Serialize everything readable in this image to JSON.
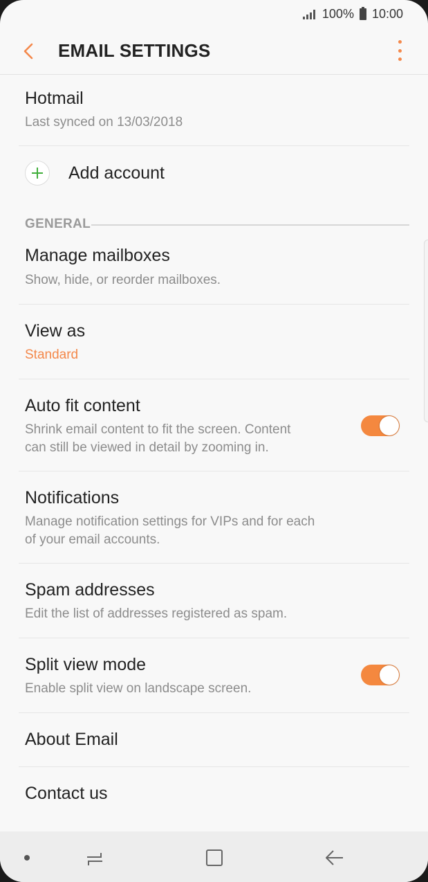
{
  "status": {
    "battery": "100%",
    "time": "10:00"
  },
  "appbar": {
    "title": "EMAIL SETTINGS"
  },
  "account": {
    "name": "Hotmail",
    "sync": "Last synced on 13/03/2018"
  },
  "add_account": {
    "label": "Add account"
  },
  "section": {
    "general": "GENERAL"
  },
  "items": {
    "manage": {
      "title": "Manage mailboxes",
      "sub": "Show, hide, or reorder mailboxes."
    },
    "view_as": {
      "title": "View as",
      "value": "Standard"
    },
    "auto_fit": {
      "title": "Auto fit content",
      "sub": "Shrink email content to fit the screen. Content\ncan still be viewed in detail by zooming in.",
      "enabled": true
    },
    "notifications": {
      "title": "Notifications",
      "sub": "Manage notification settings for VIPs and for each\nof your email accounts."
    },
    "spam": {
      "title": "Spam addresses",
      "sub": "Edit the list of addresses registered as spam."
    },
    "split": {
      "title": "Split view mode",
      "sub": "Enable split view on landscape screen.",
      "enabled": true
    },
    "about": {
      "title": "About Email"
    },
    "contact": {
      "title": "Contact us"
    }
  },
  "colors": {
    "accent": "#f4884a",
    "plus": "#3fae3a",
    "background": "#f8f8f8"
  },
  "icons": [
    "signal-icon",
    "battery-icon",
    "back-arrow-icon",
    "more-options-icon",
    "add-icon",
    "recents-icon",
    "home-icon",
    "nav-back-icon"
  ]
}
